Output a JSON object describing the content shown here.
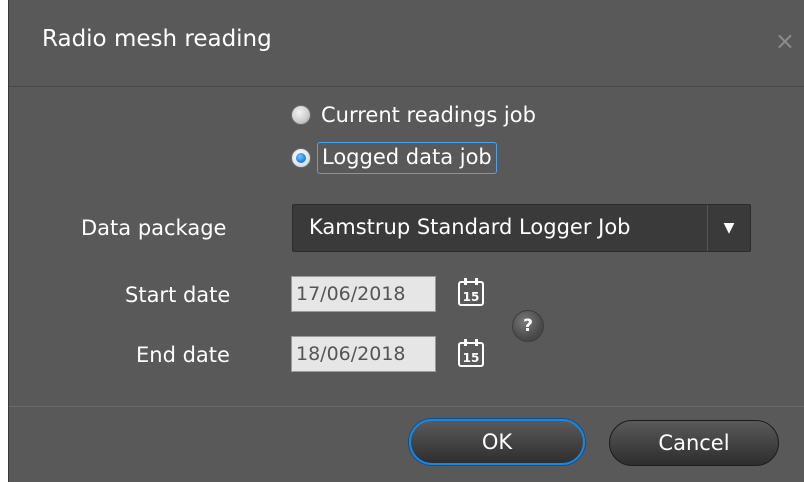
{
  "dialog": {
    "title": "Radio mesh reading",
    "close_glyph": "×"
  },
  "job_type": {
    "options": [
      {
        "label": "Current readings job",
        "selected": false
      },
      {
        "label": "Logged data job",
        "selected": true
      }
    ]
  },
  "data_package": {
    "label": "Data package",
    "value": "Kamstrup Standard Logger Job",
    "arrow_glyph": "▼"
  },
  "start_date": {
    "label": "Start date",
    "value": "17/06/2018",
    "calendar_text": "15"
  },
  "end_date": {
    "label": "End date",
    "value": "18/06/2018",
    "calendar_text": "15"
  },
  "help": {
    "glyph": "?"
  },
  "buttons": {
    "ok_label": "OK",
    "cancel_label": "Cancel"
  },
  "colors": {
    "background": "#595959",
    "accent": "#1a86e0",
    "text": "#ffffff"
  }
}
